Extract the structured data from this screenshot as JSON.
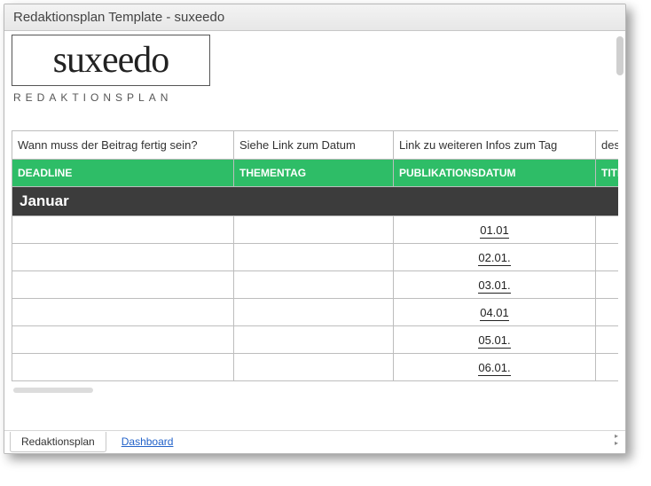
{
  "window": {
    "title": "Redaktionsplan Template - suxeedo"
  },
  "brand": {
    "logo_text": "suxeedo",
    "subtitle": "REDAKTIONSPLAN"
  },
  "descriptions": {
    "col1": "Wann muss der Beitrag fertig sein?",
    "col2": "Siehe Link zum Datum",
    "col3": "Link zu weiteren Infos zum Tag",
    "col4": "des Beitra"
  },
  "headers": {
    "col1": "DEADLINE",
    "col2": "THEMENTAG",
    "col3": "PUBLIKATIONSDATUM",
    "col4": "TITEL"
  },
  "month": {
    "name": "Januar"
  },
  "rows": [
    {
      "deadline": "",
      "thementag": "",
      "pub": "01.01",
      "titel": ""
    },
    {
      "deadline": "",
      "thementag": "",
      "pub": "02.01.",
      "titel": ""
    },
    {
      "deadline": "",
      "thementag": "",
      "pub": "03.01.",
      "titel": ""
    },
    {
      "deadline": "",
      "thementag": "",
      "pub": "04.01",
      "titel": ""
    },
    {
      "deadline": "",
      "thementag": "",
      "pub": "05.01.",
      "titel": ""
    },
    {
      "deadline": "",
      "thementag": "",
      "pub": "06.01.",
      "titel": ""
    }
  ],
  "tabs": {
    "t1": "Redaktionsplan",
    "t2": "Dashboard"
  }
}
